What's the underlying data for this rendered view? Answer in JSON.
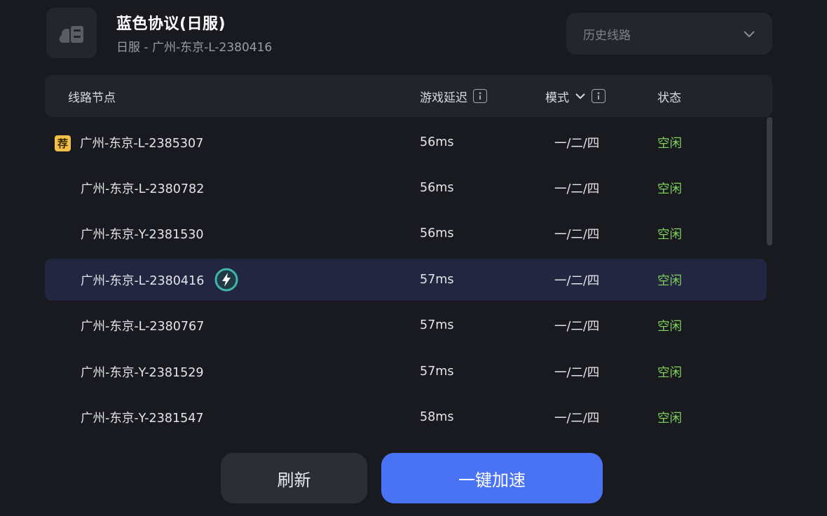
{
  "header": {
    "game_title": "蓝色协议(日服)",
    "game_subtitle": "日服 - 广州-东京-L-2380416",
    "history_placeholder": "历史线路",
    "game_icon": "cloud-server-icon"
  },
  "table": {
    "columns": {
      "node": "线路节点",
      "latency": "游戏延迟",
      "mode": "模式",
      "status": "状态"
    },
    "rows": [
      {
        "node": "广州-东京-L-2385307",
        "latency": "56ms",
        "mode": "一/二/四",
        "status": "空闲",
        "recommended": true,
        "recommend_label": "荐"
      },
      {
        "node": "广州-东京-L-2380782",
        "latency": "56ms",
        "mode": "一/二/四",
        "status": "空闲"
      },
      {
        "node": "广州-东京-Y-2381530",
        "latency": "56ms",
        "mode": "一/二/四",
        "status": "空闲"
      },
      {
        "node": "广州-东京-L-2380416",
        "latency": "57ms",
        "mode": "一/二/四",
        "status": "空闲",
        "selected": true,
        "current_icon": "lightning-bolt-icon"
      },
      {
        "node": "广州-东京-L-2380767",
        "latency": "57ms",
        "mode": "一/二/四",
        "status": "空闲"
      },
      {
        "node": "广州-东京-Y-2381529",
        "latency": "57ms",
        "mode": "一/二/四",
        "status": "空闲"
      },
      {
        "node": "广州-东京-Y-2381547",
        "latency": "58ms",
        "mode": "一/二/四",
        "status": "空闲"
      }
    ]
  },
  "buttons": {
    "refresh": "刷新",
    "boost": "一键加速"
  },
  "colors": {
    "background": "#191a20",
    "accent": "#4a72f5",
    "status_idle": "#7fd35a",
    "recommend_badge": "#f3c04a",
    "selected_row": "#222640"
  }
}
